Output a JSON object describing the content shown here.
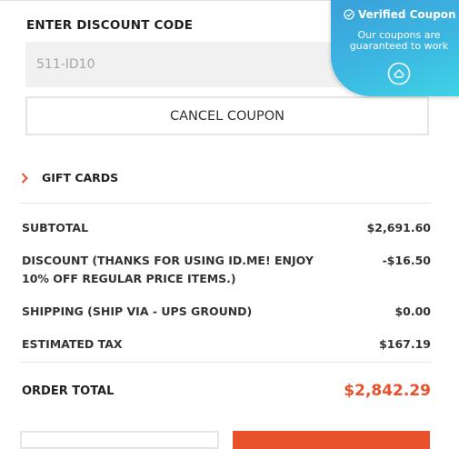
{
  "discount": {
    "title": "ENTER DISCOUNT CODE",
    "code_value": "511-ID10",
    "cancel_label": "CANCEL COUPON"
  },
  "badge": {
    "title": "Verified Coupon",
    "text": "Our coupons are guaranteed to work"
  },
  "gift": {
    "label": "GIFT CARDS"
  },
  "summary": {
    "rows": [
      {
        "label": "SUBTOTAL",
        "value": "$2,691.60"
      },
      {
        "label": "DISCOUNT (THANKS FOR USING ID.ME! ENJOY 10% OFF REGULAR PRICE ITEMS.)",
        "value": "-$16.50"
      },
      {
        "label": "SHIPPING (SHIP VIA - UPS GROUND)",
        "value": "$0.00"
      },
      {
        "label": "ESTIMATED TAX",
        "value": "$167.19"
      }
    ],
    "total_label": "ORDER TOTAL",
    "total_value": "$2,842.29"
  },
  "colors": {
    "accent": "#e8512b",
    "badge": "#3cb8e2"
  }
}
